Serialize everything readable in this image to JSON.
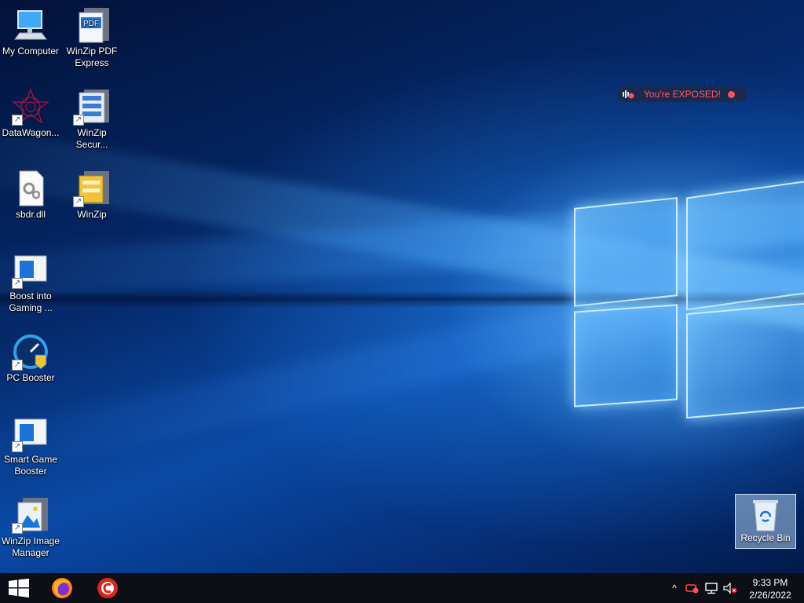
{
  "desktop": {
    "icons": [
      {
        "label": "My Computer",
        "icon": "computer-icon"
      },
      {
        "label": "WinZip PDF Express",
        "icon": "pdf-icon"
      },
      {
        "label": "DataWagon...",
        "icon": "datawagon-icon"
      },
      {
        "label": "WinZip Secur...",
        "icon": "winzip-secure-icon"
      },
      {
        "label": "sbdr.dll",
        "icon": "dll-file-icon"
      },
      {
        "label": "WinZip",
        "icon": "winzip-icon"
      },
      {
        "label": "Boost into Gaming ...",
        "icon": "boost-gaming-icon"
      },
      {
        "label": "PC Booster",
        "icon": "pc-booster-icon"
      },
      {
        "label": "Smart Game Booster",
        "icon": "smart-game-booster-icon"
      },
      {
        "label": "WinZip Image Manager",
        "icon": "winzip-image-manager-icon"
      }
    ],
    "recycle_bin": {
      "label": "Recycle Bin",
      "icon": "recycle-bin-icon"
    },
    "exposed_badge": {
      "text": "You're EXPOSED!"
    }
  },
  "taskbar": {
    "start": {
      "icon": "windows-start-icon"
    },
    "pinned": [
      {
        "icon": "firefox-icon"
      },
      {
        "icon": "ccleaner-icon"
      }
    ],
    "tray": {
      "chevron": "^",
      "time": "9:33 PM",
      "date": "2/26/2022"
    }
  },
  "colors": {
    "taskbar": "#0c0f16",
    "exposed_text": "#ff5a5a",
    "accent": "#1a74d8"
  }
}
